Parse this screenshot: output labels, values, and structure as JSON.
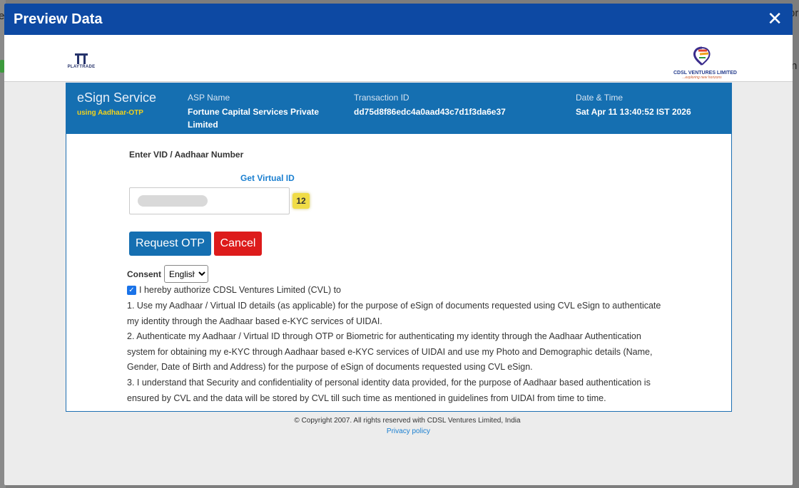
{
  "background": {
    "frag_left_top": "ea",
    "frag_right_top": "or",
    "frag_right_mid": "n"
  },
  "modal": {
    "title": "Preview Data",
    "close_label": "✕"
  },
  "logos": {
    "playtrade_text": "PLAYTRADE",
    "cdsl_name": "CDSL VENTURES LIMITED",
    "cdsl_tagline": "...exploring new horizons"
  },
  "esign": {
    "service_title": "eSign Service",
    "service_subtitle": "using Aadhaar-OTP",
    "asp_label": "ASP Name",
    "asp_value": "Fortune Capital Services Private Limited",
    "txn_label": "Transaction ID",
    "txn_value": "dd75d8f86edc4a0aad43c7d1f3da6e37",
    "date_label": "Date & Time",
    "date_value": "Sat Apr 11 13:40:52 IST 2026"
  },
  "form": {
    "vid_label": "Enter VID / Aadhaar Number",
    "virtual_id_link": "Get Virtual ID",
    "digit_count": "12",
    "request_otp": "Request OTP",
    "cancel": "Cancel",
    "consent_label": "Consent",
    "language": "English",
    "authorize_text": "I hereby authorize CDSL Ventures Limited (CVL) to",
    "consent_points": [
      "1. Use my Aadhaar / Virtual ID details (as applicable) for the purpose of eSign of documents requested using CVL eSign to authenticate my identity through the Aadhaar based e-KYC services of UIDAI.",
      "2. Authenticate my Aadhaar / Virtual ID through OTP or Biometric for authenticating my identity through the Aadhaar Authentication system for obtaining my e-KYC through Aadhaar based e-KYC services of UIDAI and use my Photo and Demographic details (Name, Gender, Date of Birth and Address) for the purpose of eSign of documents requested using CVL eSign.",
      "3. I understand that Security and confidentiality of personal identity data provided, for the purpose of Aadhaar based authentication is ensured by CVL and the data will be stored by CVL till such time as mentioned in guidelines from UIDAI from time to time."
    ]
  },
  "footer": {
    "copyright": "© Copyright 2007. All rights reserved with CDSL Ventures Limited, India",
    "privacy": "Privacy policy"
  },
  "colors": {
    "header_blue": "#0d49a3",
    "esign_blue": "#156fb1",
    "cancel_red": "#dd1b1b",
    "accent_yellow": "#f2d21b"
  },
  "icons": [
    "close-icon",
    "checkbox-checked-icon",
    "playtrade-logo",
    "cdsl-logo"
  ]
}
